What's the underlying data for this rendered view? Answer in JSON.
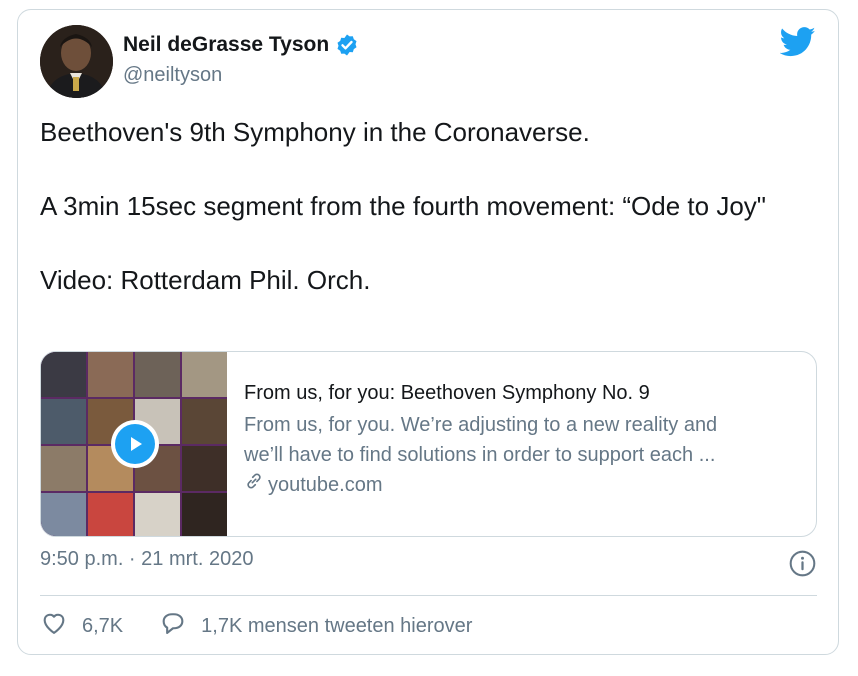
{
  "author": {
    "name": "Neil deGrasse Tyson",
    "handle": "@neiltyson",
    "verified": true
  },
  "icons": {
    "logo": "twitter-bird-icon",
    "verified": "verified-badge-icon",
    "like": "heart-icon",
    "reply": "speech-bubble-icon",
    "info": "info-icon",
    "link": "link-icon",
    "play": "play-icon"
  },
  "colors": {
    "brand": "#1da1f2",
    "text": "#14171a",
    "muted": "#657786",
    "border": "#cfd9de"
  },
  "tweet": {
    "line1": "Beethoven's 9th Symphony in the Coronaverse.",
    "line2": "A 3min 15sec segment from the fourth movement: “Ode to Joy\"",
    "line3": "Video: Rotterdam Phil. Orch."
  },
  "link_card": {
    "title": "From us, for you: Beethoven Symphony No. 9",
    "description_line1": "From us, for you. We’re adjusting to a new reality and",
    "description_line2": "we’ll have to find solutions in order to support each ...",
    "domain": "youtube.com"
  },
  "meta": {
    "timestamp": "9:50 p.m. · 21 mrt. 2020"
  },
  "actions": {
    "likes": "6,7K",
    "retweets_text": "1,7K mensen tweeten hierover"
  }
}
